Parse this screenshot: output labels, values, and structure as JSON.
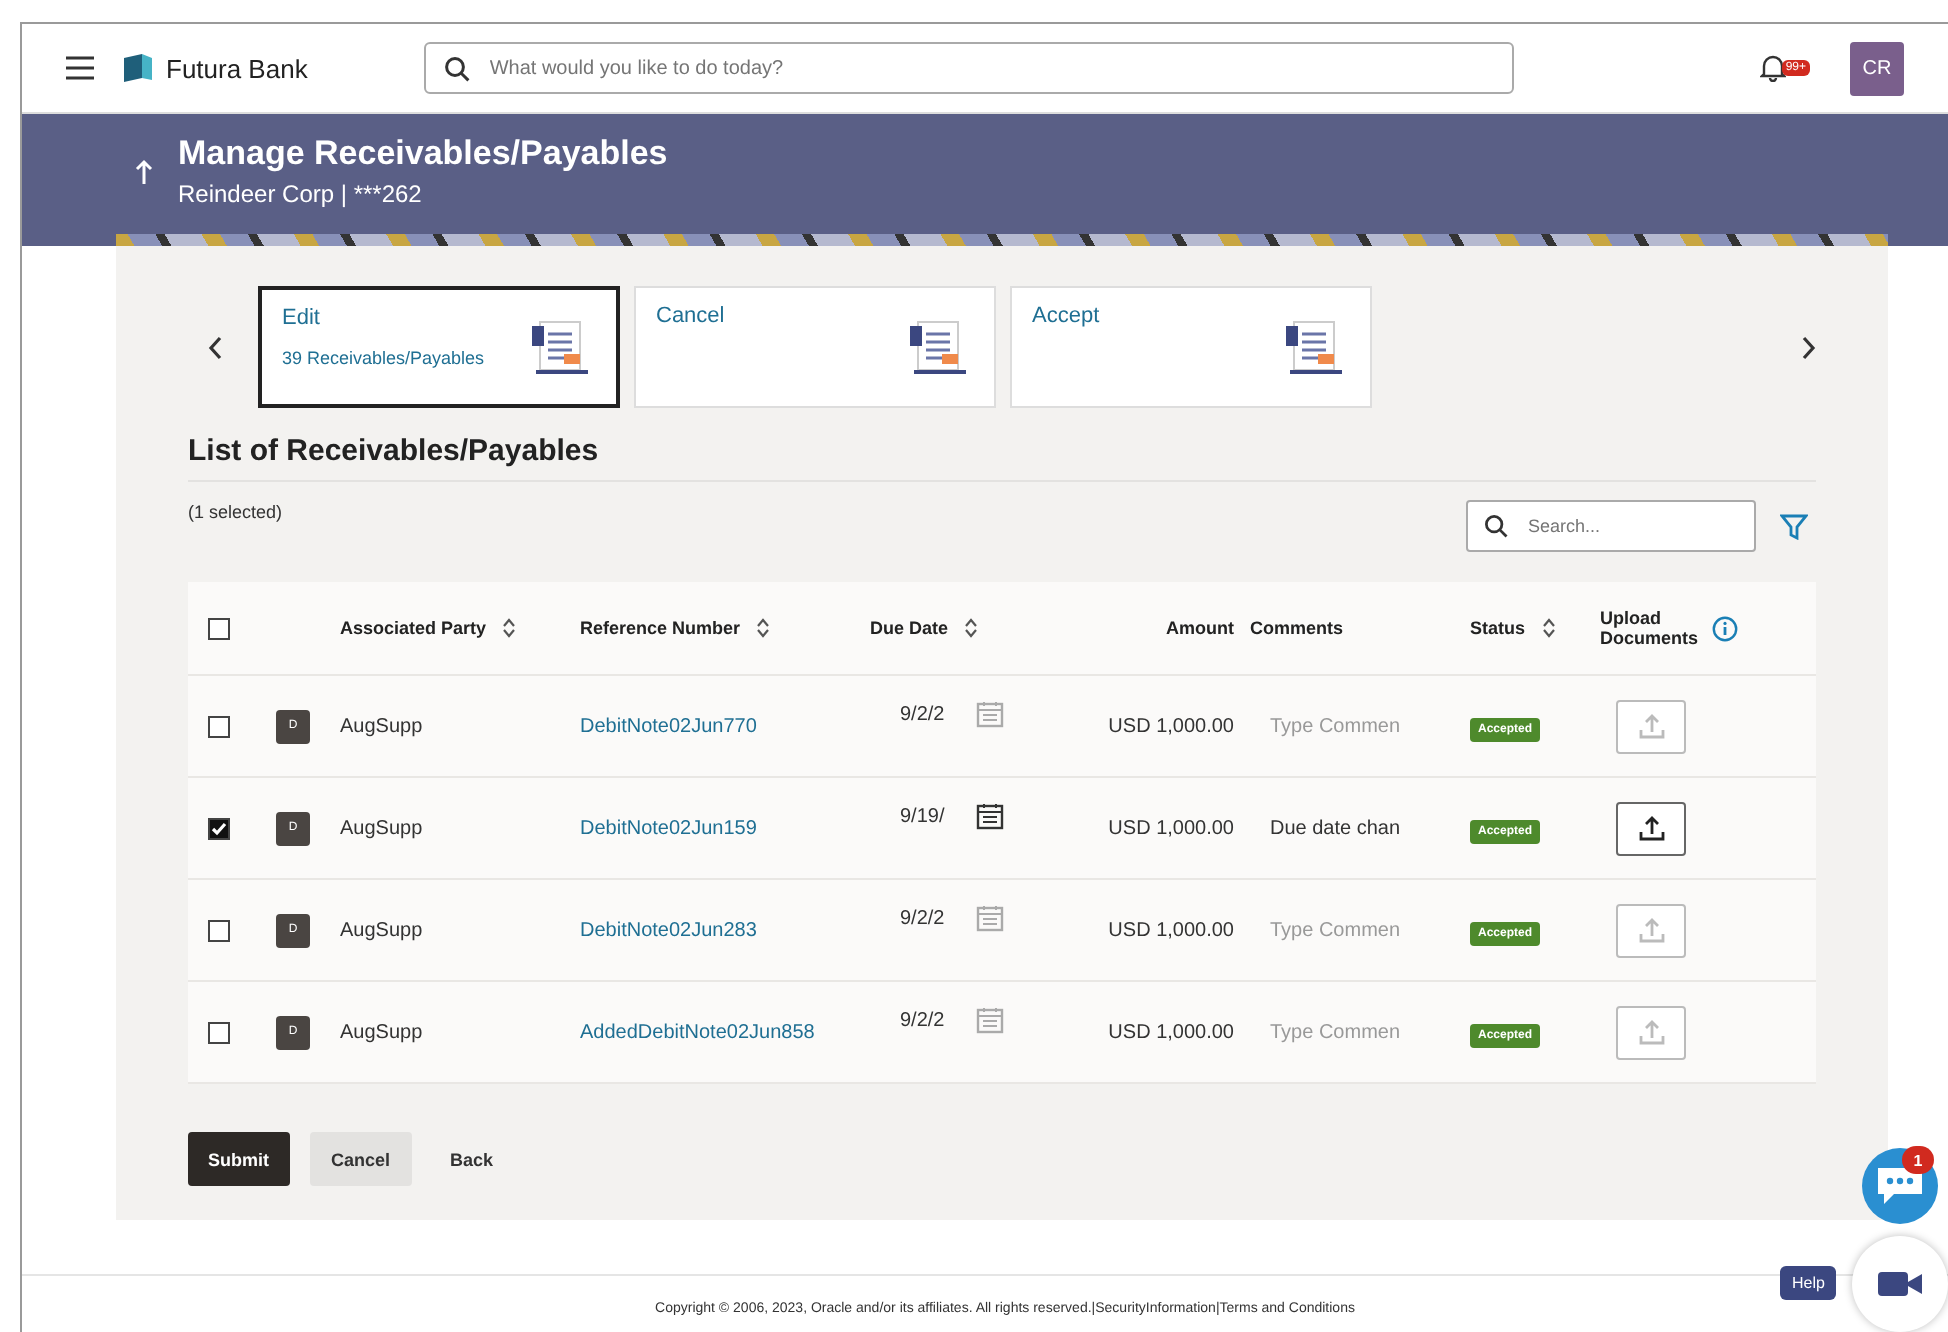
{
  "header": {
    "brand": "Futura Bank",
    "search": {
      "placeholder": "What would you like to do today?"
    },
    "notification_badge": "99+",
    "avatar": "CR"
  },
  "page": {
    "title": "Manage Receivables/Payables",
    "subtitle": "Reindeer Corp | ***262"
  },
  "actions": [
    {
      "title": "Edit",
      "count": "39 Receivables/Payables",
      "selected": true
    },
    {
      "title": "Cancel",
      "selected": false
    },
    {
      "title": "Accept",
      "selected": false
    }
  ],
  "list": {
    "title": "List of Receivables/Payables",
    "selection_count": "(1 selected)",
    "search": {
      "placeholder": "Search..."
    },
    "select_all_checked": false,
    "columns": [
      {
        "label": "Associated Party",
        "sortable": true
      },
      {
        "label": "Reference Number",
        "sortable": true
      },
      {
        "label": "Due Date",
        "sortable": true
      },
      {
        "label": "Amount",
        "sortable": false
      },
      {
        "label": "Comments",
        "sortable": false
      },
      {
        "label": "Status",
        "sortable": true
      },
      {
        "label": "Upload Documents",
        "sortable": false,
        "info": true
      }
    ],
    "rows": [
      {
        "checked": false,
        "badge": "D",
        "party": "AugSupp",
        "reference": "DebitNote02Jun770",
        "due_date": "9/2/2",
        "amount": "USD 1,000.00",
        "comment": {
          "placeholder": "Type Commen"
        },
        "status": "Accepted"
      },
      {
        "checked": true,
        "badge": "D",
        "party": "AugSupp",
        "reference": "DebitNote02Jun159",
        "due_date": "9/19/",
        "amount": "USD 1,000.00",
        "comment": {
          "value": "Due date chan"
        },
        "status": "Accepted"
      },
      {
        "checked": false,
        "badge": "D",
        "party": "AugSupp",
        "reference": "DebitNote02Jun283",
        "due_date": "9/2/2",
        "amount": "USD 1,000.00",
        "comment": {
          "placeholder": "Type Commen"
        },
        "status": "Accepted"
      },
      {
        "checked": false,
        "badge": "D",
        "party": "AugSupp",
        "reference": "AddedDebitNote02Jun858",
        "due_date": "9/2/2",
        "amount": "USD 1,000.00",
        "comment": {
          "placeholder": "Type Commen"
        },
        "status": "Accepted"
      }
    ]
  },
  "buttons": [
    {
      "label": "Submit",
      "kind": "primary"
    },
    {
      "label": "Cancel",
      "kind": "secondary"
    },
    {
      "label": "Back",
      "kind": "link"
    }
  ],
  "footer": {
    "copyright": "Copyright © 2006, 2023, Oracle and/or its affiliates. All rights reserved.",
    "separator": "|",
    "links": [
      "SecurityInformation",
      "Terms and Conditions"
    ]
  },
  "chat": {
    "badge": "1"
  },
  "help": "Help"
}
